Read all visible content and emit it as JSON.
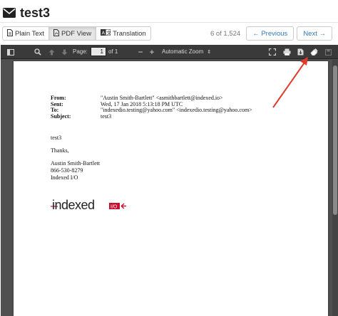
{
  "header": {
    "title": "test3",
    "icon": "envelope-icon"
  },
  "tabs": [
    {
      "label": "Plain Text",
      "icon": "document-icon",
      "active": false
    },
    {
      "label": "PDF View",
      "icon": "pdf-icon",
      "active": true
    },
    {
      "label": "Translation",
      "icon": "translate-icon",
      "active": false
    }
  ],
  "pager": {
    "count": "6 of 1,524",
    "previous": "← Previous",
    "next": "Next →"
  },
  "toolbar": {
    "page_label": "Page:",
    "page_value": "1",
    "page_total": "of 1",
    "zoom": "Automatic Zoom"
  },
  "email": {
    "headers": [
      {
        "key": "From:",
        "value": "\"Austin Smith-Bartlett\" <asmithbartlett@indexed.io>"
      },
      {
        "key": "Sent:",
        "value": "Wed, 17 Jan 2018 5:13:18 PM UTC"
      },
      {
        "key": "To:",
        "value": "\"indexedio.testing@yahoo.com\" <indexedio.testing@yahoo.com>"
      },
      {
        "key": "Subject:",
        "value": "test3"
      }
    ],
    "body": "test3",
    "closing": "Thanks,",
    "signature": [
      "Austin Smith-Bartlett",
      "866-530-8279",
      "Indexed I/O"
    ],
    "logo_text": "indexed",
    "logo_badge": "I/O"
  },
  "colors": {
    "accent": "#337ab7",
    "annotation_arrow": "#e03c2d",
    "logo_red": "#c8102e"
  }
}
